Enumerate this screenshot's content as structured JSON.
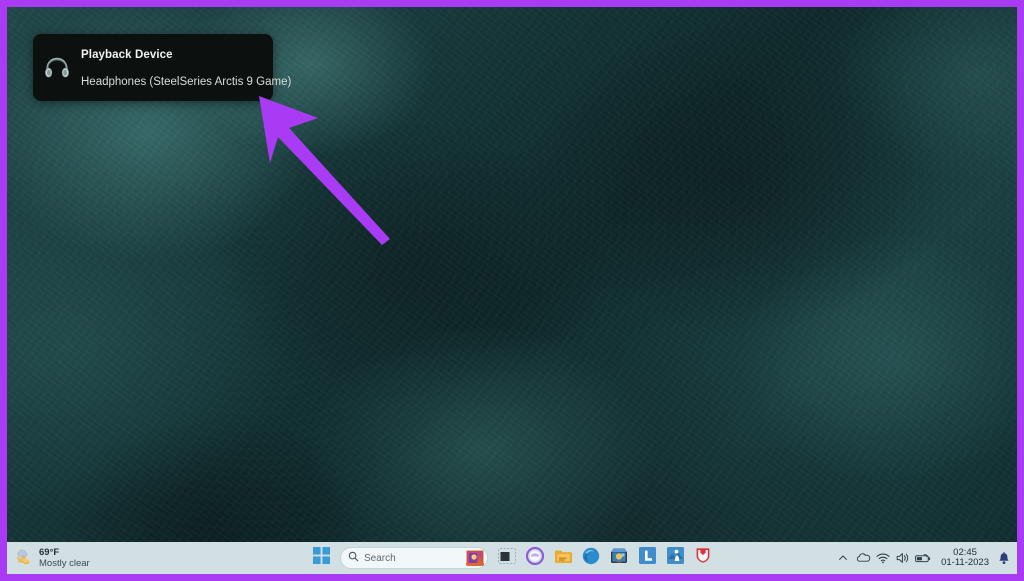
{
  "annotation": {
    "frame_color": "#A93BF5",
    "arrow_color": "#A93BF5",
    "arrow_name": "purple-pointer-arrow"
  },
  "desktop": {
    "wallpaper_description": "dark teal mottled marble texture",
    "base_color": "#1d3a3a"
  },
  "toast": {
    "name": "playback-device-notification",
    "icon": "headphones-icon",
    "title": "Playback Device",
    "subtitle": "Headphones (SteelSeries Arctis 9 Game)"
  },
  "taskbar": {
    "background_color": "#D2E0E4",
    "weather": {
      "icon": "moon-cloud-icon",
      "temperature": "69°F",
      "condition": "Mostly clear"
    },
    "start_button": {
      "label": "Start",
      "icon": "windows-logo-icon"
    },
    "search": {
      "icon": "search-icon",
      "placeholder": "Search",
      "thumbnail": "search-highlight-thumbnail"
    },
    "apps": [
      {
        "name": "task-view",
        "icon": "task-view-icon",
        "label": "Task View"
      },
      {
        "name": "copilot",
        "icon": "copilot-icon",
        "label": "Copilot"
      },
      {
        "name": "file-explorer",
        "icon": "folder-icon",
        "label": "File Explorer"
      },
      {
        "name": "microsoft-edge",
        "icon": "edge-icon",
        "label": "Microsoft Edge"
      },
      {
        "name": "microsoft-store",
        "icon": "store-icon",
        "label": "Microsoft Store"
      },
      {
        "name": "app-l",
        "icon": "letter-l-icon",
        "label": "L"
      },
      {
        "name": "app-person",
        "icon": "person-blue-icon",
        "label": "App"
      },
      {
        "name": "security-shield",
        "icon": "shield-icon",
        "label": "Security"
      }
    ],
    "tray": {
      "overflow": {
        "name": "show-hidden-icons",
        "icon": "chevron-up-icon"
      },
      "cloud": {
        "name": "onedrive",
        "icon": "cloud-icon"
      },
      "network": {
        "name": "network",
        "icon": "wifi-icon"
      },
      "volume": {
        "name": "volume",
        "icon": "speaker-icon"
      },
      "battery": {
        "name": "battery",
        "icon": "battery-icon"
      },
      "time": "02:45",
      "date": "01-11-2023",
      "notifications": {
        "name": "notifications",
        "icon": "bell-icon"
      }
    }
  }
}
